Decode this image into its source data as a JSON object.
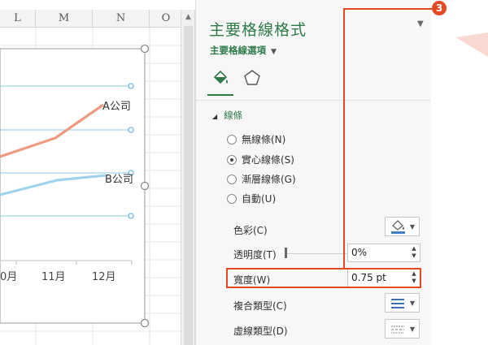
{
  "sheet": {
    "columns": [
      "L",
      "M",
      "N",
      "O"
    ],
    "chart": {
      "x_labels": [
        "0月",
        "11月",
        "12月"
      ],
      "series_labels": [
        "A公司",
        "B公司"
      ],
      "colors": {
        "series_a": "#ee9a80",
        "series_b": "#9fd3ec",
        "gridline": "#8fc9e6",
        "handle": "#6dbbe3"
      }
    }
  },
  "pane": {
    "title": "主要格線格式",
    "options_label": "主要格線選項",
    "tabs": [
      "fill-line-icon",
      "effects-pentagon-icon"
    ],
    "section_title": "線條",
    "radios": [
      {
        "label": "無線條(N)",
        "selected": false
      },
      {
        "label": "實心線條(S)",
        "selected": true
      },
      {
        "label": "漸層線條(G)",
        "selected": false
      },
      {
        "label": "自動(U)",
        "selected": false
      }
    ],
    "color_label": "色彩(C)",
    "transparency_label": "透明度(T)",
    "transparency_value": "0%",
    "width_label": "寬度(W)",
    "width_value": "0.75 pt",
    "compound_label": "複合類型(C)",
    "dash_label": "虛線類型(D)"
  },
  "callout": {
    "number": "3",
    "color": "#e34a21"
  }
}
